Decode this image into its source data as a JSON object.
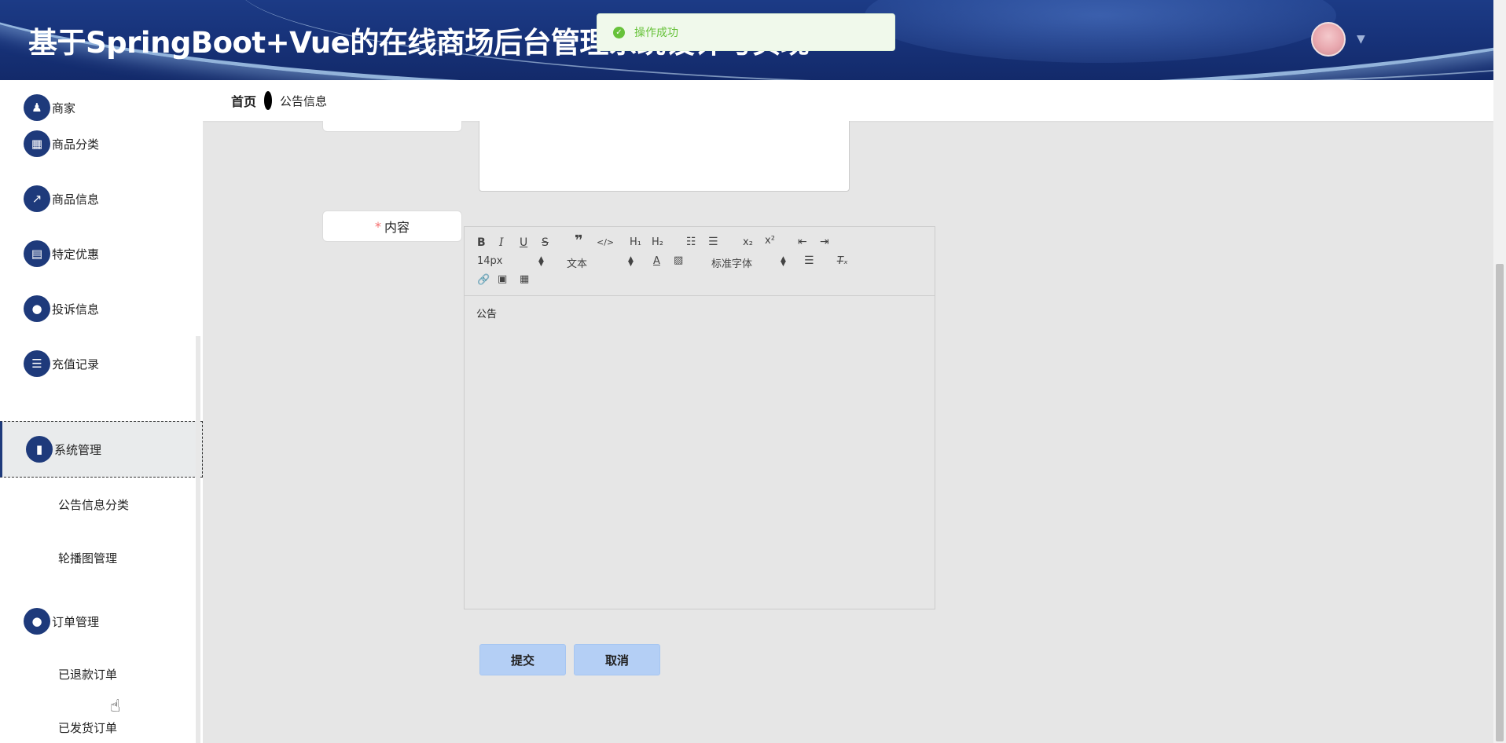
{
  "header": {
    "title": "基于SpringBoot+Vue的在线商场后台管理系统设计与实现"
  },
  "toast": {
    "message": "操作成功"
  },
  "breadcrumb": {
    "home": "首页",
    "current": "公告信息"
  },
  "sidebar": {
    "items": [
      {
        "label": "商家",
        "icon": "store-icon",
        "glyph": "♟"
      },
      {
        "label": "商品分类",
        "icon": "grid-icon",
        "glyph": "▦"
      },
      {
        "label": "商品信息",
        "icon": "chart-line-icon",
        "glyph": "↗"
      },
      {
        "label": "特定优惠",
        "icon": "clipboard-icon",
        "glyph": "▤"
      },
      {
        "label": "投诉信息",
        "icon": "user-icon",
        "glyph": "●"
      },
      {
        "label": "充值记录",
        "icon": "list-icon",
        "glyph": "☰"
      },
      {
        "label": "系统管理",
        "icon": "bar-chart-icon",
        "glyph": "▮"
      },
      {
        "label": "订单管理",
        "icon": "lightbulb-icon",
        "glyph": "●"
      }
    ],
    "sub_system": [
      "公告信息分类",
      "轮播图管理"
    ],
    "sub_order": [
      "已退款订单",
      "已发货订单"
    ]
  },
  "form": {
    "content_label": "内容",
    "content_required": "*",
    "summary_text": "公告",
    "editor": {
      "font_size": "14px",
      "header_select": "文本",
      "font_family": "标准字体",
      "content": "公告"
    },
    "submit_label": "提交",
    "cancel_label": "取消"
  },
  "colors": {
    "header_bg": "#1c3b86",
    "sidebar_icon_bg": "#1e3a7b",
    "button_bg": "#b4cff5",
    "toast_text": "#67c23a",
    "required": "#f56c6c"
  }
}
